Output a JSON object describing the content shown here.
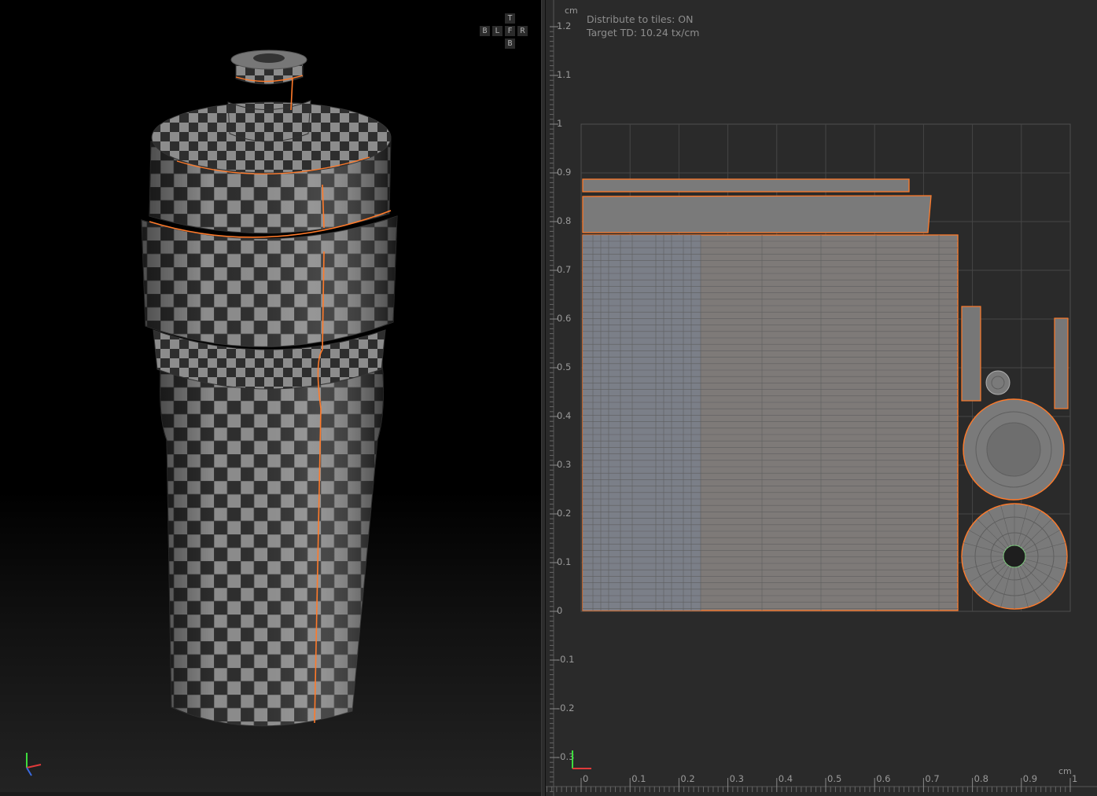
{
  "viewport": {
    "nav_cube": {
      "top": "T",
      "back": "B",
      "left": "L",
      "front": "F",
      "right": "R",
      "bottom": "B"
    },
    "axis_gizmo_icon": "xyz-gizmo-icon"
  },
  "uv_editor": {
    "info": {
      "distribute": "Distribute to tiles: ON",
      "target_td": "Target TD: 10.24 tx/cm"
    },
    "unit_label_v": "cm",
    "unit_label_u": "cm",
    "v_ticks": [
      "1.2",
      "1.1",
      "1",
      "0.9",
      "0.8",
      "0.7",
      "0.6",
      "0.5",
      "0.4",
      "0.3",
      "0.2",
      "0.1",
      "0",
      "-0.1",
      "-0.2",
      "-0.3"
    ],
    "u_ticks": [
      "0",
      "0.1",
      "0.2",
      "0.3",
      "0.4",
      "0.5",
      "0.6",
      "0.7",
      "0.8",
      "0.9",
      "1"
    ],
    "colors": {
      "seam": "#ff7a2a",
      "shell_fill": "#7c7c7c",
      "wire": "#5a5a5a",
      "grid": "#4a4a4a",
      "background": "#2a2a2a"
    }
  }
}
